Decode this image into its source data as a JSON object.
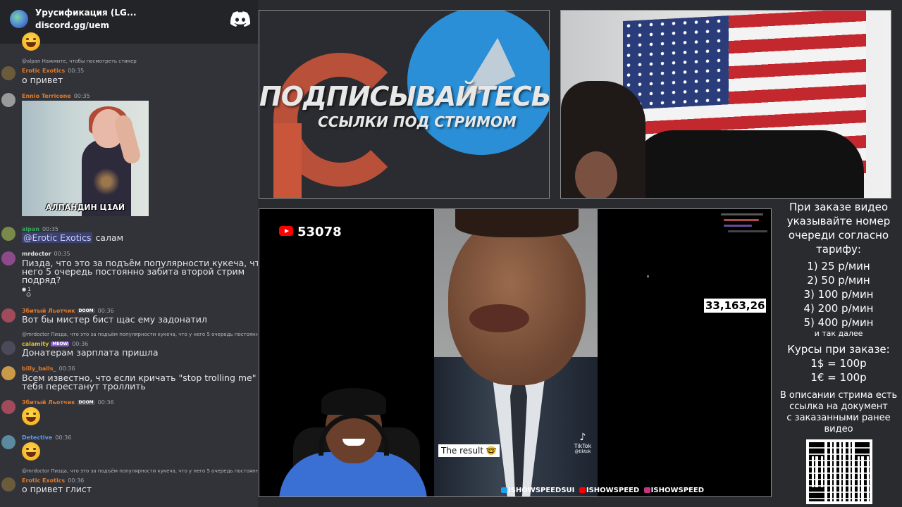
{
  "discord": {
    "server_name": "Урусификация (LG...",
    "invite_link": "discord.gg/uem",
    "messages": [
      {
        "reply": "@alpan Нажмите, чтобы посмотреть стикер",
        "user": "Erotic Exotics",
        "time": "00:35",
        "text": "о привет"
      },
      {
        "user": "Ennio Terricone",
        "time": "00:35",
        "sticker_caption": "АЛПАНДИН Ц1АЙ"
      },
      {
        "user": "alpan",
        "time": "00:35",
        "mention": "@Erotic Exotics",
        "text": "салам"
      },
      {
        "user": "mrdoctor",
        "time": "00:35",
        "text_lines": [
          "Пизда, что это за подъём популярности кукеча, что у",
          "него 5 очередь постоянно забита второй стрим",
          "подряд?"
        ],
        "reaction_count": "1"
      },
      {
        "user": "Збитый Льотчик",
        "badge": "DOOM",
        "time": "00:36",
        "text": "Вот бы мистер бист щас ему задонатил"
      },
      {
        "reply": "@mrdoctor Пизда, что это за подъём популярности кукеча, что у него 5 очередь постоянно забита",
        "user": "calamity",
        "badge": "MEOW",
        "time": "00:36",
        "text": "Донатерам зарплата пришла"
      },
      {
        "user": "billy_balls_",
        "time": "00:36",
        "text_lines": [
          "Всем известно, что если кричать \"stop trolling me\"",
          "тебя перестанут троллить"
        ]
      },
      {
        "user": "Збитый Льотчик",
        "badge": "DOOM",
        "time": "00:36"
      },
      {
        "user": "Detective",
        "time": "00:36"
      },
      {
        "reply": "@mrdoctor Пизда, что это за подъём популярности кукеча, что у него 5 очередь постоянно забита",
        "user": "Erotic Exotics",
        "time": "00:36",
        "text": "о привет глист"
      }
    ]
  },
  "promo": {
    "title": "ПОДПИСЫВАЙТЕСЬ",
    "subtitle": "ССЫЛКИ ПОД СТРИМОМ"
  },
  "video": {
    "youtube_count": "53078",
    "counter": "33,163,26",
    "result_label": "The result 🤓",
    "tiktok_label": "TikTok",
    "tiktok_handle": "@tiktok",
    "socials": [
      "ISHOWSPEEDSUI",
      "ISHOWSPEED",
      "ISHOWSPEED"
    ]
  },
  "info": {
    "heading_lines": [
      "При заказе видео",
      "указывайте номер",
      "очереди согласно",
      "тарифу:"
    ],
    "tariffs": [
      "1) 25 р/мин",
      "2) 50 р/мин",
      "3) 100 р/мин",
      "4) 200 р/мин",
      "5) 400 р/мин"
    ],
    "etc": "и так далее",
    "rates_title": "Курсы при заказе:",
    "rates": [
      "1$ = 100р",
      "1€ = 100р"
    ],
    "note_lines": [
      "В описании стрима есть",
      "ссылка на документ",
      "с заказанными ранее",
      "видео"
    ]
  },
  "colors": {
    "chat_bg": "#313338",
    "chat_header_bg": "#232428",
    "mention_bg": "#3c4270",
    "user_orange": "#e07a2a",
    "user_red": "#d9534f",
    "user_green": "#3ba55d",
    "user_blue": "#5865f2"
  }
}
